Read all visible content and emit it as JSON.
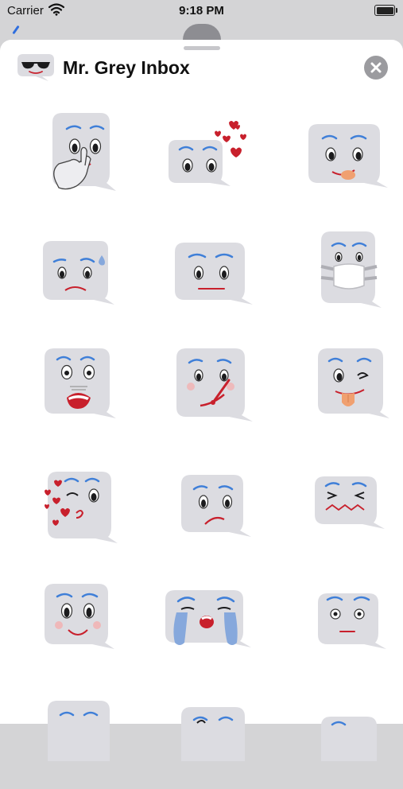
{
  "status_bar": {
    "carrier": "Carrier",
    "time": "9:18 PM"
  },
  "sheet": {
    "title": "Mr. Grey Inbox"
  },
  "stickers": [
    {
      "name": "shush"
    },
    {
      "name": "love-hearts"
    },
    {
      "name": "tongue-lick"
    },
    {
      "name": "worried-sweat"
    },
    {
      "name": "neutral"
    },
    {
      "name": "face-mask"
    },
    {
      "name": "shocked"
    },
    {
      "name": "thermometer"
    },
    {
      "name": "wink-tongue"
    },
    {
      "name": "blowing-kiss"
    },
    {
      "name": "sad"
    },
    {
      "name": "grimace"
    },
    {
      "name": "smile-blush"
    },
    {
      "name": "crying"
    },
    {
      "name": "surprised"
    },
    {
      "name": "partial-1"
    },
    {
      "name": "partial-2"
    },
    {
      "name": "partial-3"
    }
  ],
  "colors": {
    "bubble": "#dcdce1",
    "brow": "#3f7fd8",
    "mouth": "#c8202c",
    "tears": "#86a8dc",
    "tongue": "#f0a070"
  }
}
